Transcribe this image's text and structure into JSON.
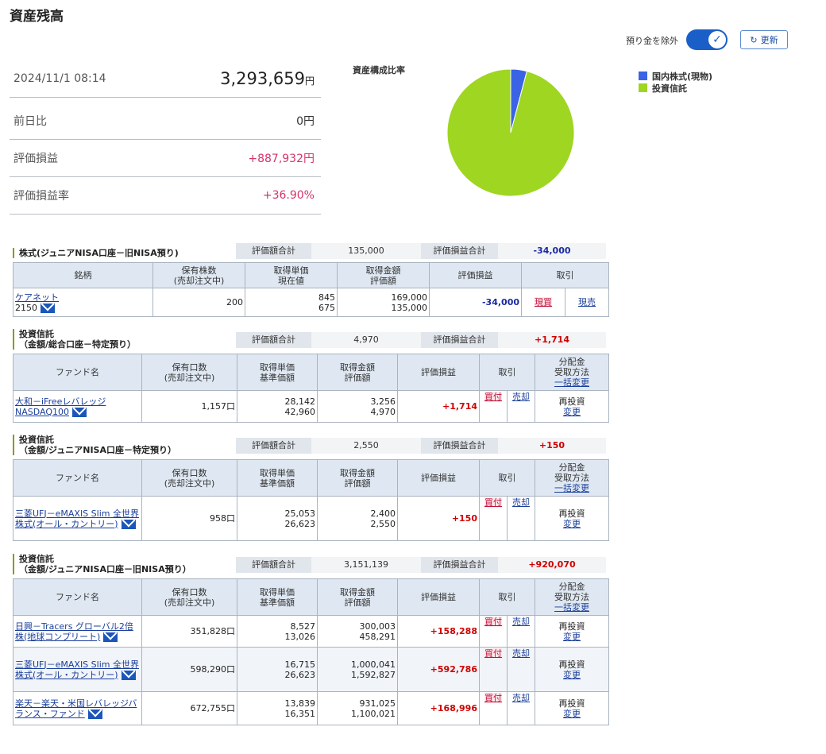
{
  "page": {
    "title": "資産残高"
  },
  "controls": {
    "exclude_label": "預り金を除外",
    "toggle_on": true,
    "refresh_label": "更新"
  },
  "summary": {
    "datetime": "2024/11/1 08:14",
    "total_value": "3,293,659",
    "total_unit": "円",
    "rows": [
      {
        "label": "前日比",
        "value": "0円"
      },
      {
        "label": "評価損益",
        "value": "+887,932円"
      },
      {
        "label": "評価損益率",
        "value": "+36.90%"
      }
    ]
  },
  "allocation": {
    "title": "資産構成比率",
    "legend": [
      {
        "name": "国内株式(現物)",
        "color": "#3a63e6"
      },
      {
        "name": "投資信託",
        "color": "#9ed622"
      }
    ]
  },
  "chart_data": {
    "type": "pie",
    "title": "資産構成比率",
    "labels": [
      "国内株式(現物)",
      "投資信託"
    ],
    "values": [
      135000,
      3158659
    ],
    "colors": [
      "#3a63e6",
      "#9ed622"
    ]
  },
  "sections": {
    "stock": {
      "title": "株式(ジュニアNISA口座－旧NISA預り)",
      "eval_total_label": "評価額合計",
      "eval_total": "135,000",
      "pl_total_label": "評価損益合計",
      "pl_total": "-34,000",
      "headers": [
        "銘柄",
        "保有株数\n(売却注文中)",
        "取得単価\n現在値",
        "取得金額\n評価額",
        "評価損益",
        "取引"
      ],
      "rows": [
        {
          "name": "ケアネット",
          "code": "2150",
          "qty": "200",
          "cost_price": "845",
          "cur_price": "675",
          "cost_amount": "169,000",
          "eval_amount": "135,000",
          "pl": "-34,000",
          "buy": "現買",
          "sell": "現売"
        }
      ]
    },
    "fund1": {
      "title": "投資信託",
      "subtitle": "（金額/総合口座－特定預り）",
      "eval_total_label": "評価額合計",
      "eval_total": "4,970",
      "pl_total_label": "評価損益合計",
      "pl_total": "+1,714",
      "headers": [
        "ファンド名",
        "保有口数\n(売却注文中)",
        "取得単価\n基準価額",
        "取得金額\n評価額",
        "評価損益",
        "取引"
      ],
      "dist_header": [
        "分配金",
        "受取方法"
      ],
      "dist_link": "一括変更",
      "rows": [
        {
          "name": "大和－iFreeレバレッジ NASDAQ100",
          "qty": "1,157口",
          "cost_price": "28,142",
          "nav": "42,960",
          "cost_amount": "3,256",
          "eval_amount": "4,970",
          "pl": "+1,714",
          "buy": "買付",
          "sell": "売却",
          "dist": "再投資",
          "change": "変更"
        }
      ]
    },
    "fund2": {
      "title": "投資信託",
      "subtitle": "（金額/ジュニアNISA口座－特定預り）",
      "eval_total_label": "評価額合計",
      "eval_total": "2,550",
      "pl_total_label": "評価損益合計",
      "pl_total": "+150",
      "headers": [
        "ファンド名",
        "保有口数\n(売却注文中)",
        "取得単価\n基準価額",
        "取得金額\n評価額",
        "評価損益",
        "取引"
      ],
      "dist_header": [
        "分配金",
        "受取方法"
      ],
      "dist_link": "一括変更",
      "rows": [
        {
          "name": "三菱UFJ－eMAXIS Slim 全世界株式(オール・カントリー)",
          "qty": "958口",
          "cost_price": "25,053",
          "nav": "26,623",
          "cost_amount": "2,400",
          "eval_amount": "2,550",
          "pl": "+150",
          "buy": "買付",
          "sell": "売却",
          "dist": "再投資",
          "change": "変更"
        }
      ]
    },
    "fund3": {
      "title": "投資信託",
      "subtitle": "（金額/ジュニアNISA口座－旧NISA預り）",
      "eval_total_label": "評価額合計",
      "eval_total": "3,151,139",
      "pl_total_label": "評価損益合計",
      "pl_total": "+920,070",
      "headers": [
        "ファンド名",
        "保有口数\n(売却注文中)",
        "取得単価\n基準価額",
        "取得金額\n評価額",
        "評価損益",
        "取引"
      ],
      "dist_header": [
        "分配金",
        "受取方法"
      ],
      "dist_link": "一括変更",
      "rows": [
        {
          "name": "日興－Tracers グローバル2倍株(地球コンプリート)",
          "qty": "351,828口",
          "cost_price": "8,527",
          "nav": "13,026",
          "cost_amount": "300,003",
          "eval_amount": "458,291",
          "pl": "+158,288",
          "buy": "買付",
          "sell": "売却",
          "dist": "再投資",
          "change": "変更"
        },
        {
          "name": "三菱UFJ－eMAXIS Slim 全世界株式(オール・カントリー)",
          "qty": "598,290口",
          "cost_price": "16,715",
          "nav": "26,623",
          "cost_amount": "1,000,041",
          "eval_amount": "1,592,827",
          "pl": "+592,786",
          "buy": "買付",
          "sell": "売却",
          "dist": "再投資",
          "change": "変更"
        },
        {
          "name": "楽天－楽天・米国レバレッジバランス・ファンド",
          "qty": "672,755口",
          "cost_price": "13,839",
          "nav": "16,351",
          "cost_amount": "931,025",
          "eval_amount": "1,100,021",
          "pl": "+168,996",
          "buy": "買付",
          "sell": "売却",
          "dist": "再投資",
          "change": "変更"
        }
      ]
    }
  }
}
